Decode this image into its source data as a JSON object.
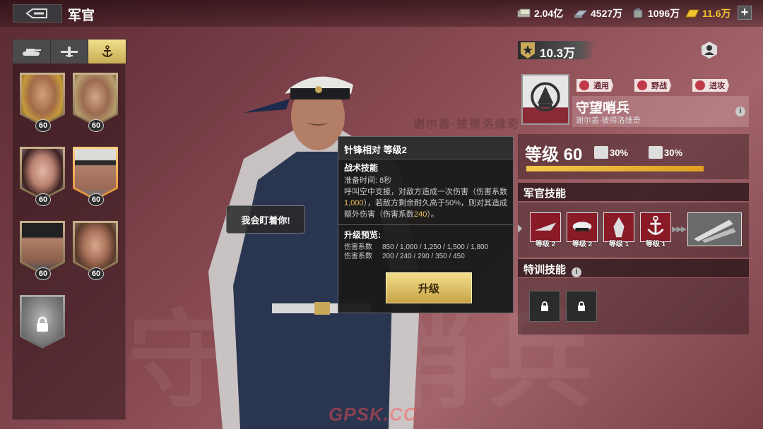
{
  "header": {
    "title": "军官",
    "resources": [
      {
        "icon": "cash-icon",
        "value": "2.04亿"
      },
      {
        "icon": "steel-icon",
        "value": "4527万"
      },
      {
        "icon": "oil-icon",
        "value": "1096万"
      },
      {
        "icon": "gold-icon",
        "value": "11.6万"
      }
    ],
    "plus": "+"
  },
  "tabs": [
    {
      "name": "tank-icon",
      "active": false
    },
    {
      "name": "plane-icon",
      "active": false
    },
    {
      "name": "anchor-icon",
      "active": true
    }
  ],
  "officers": [
    {
      "level": "60"
    },
    {
      "level": "60"
    },
    {
      "level": "60"
    },
    {
      "level": "60"
    },
    {
      "level": "60"
    },
    {
      "level": "60"
    },
    {
      "locked": true
    }
  ],
  "speech": "我会盯着你!",
  "background_text": "谢尔盖·彼得洛维奇",
  "background_glyphs": [
    "守",
    "望",
    "哨",
    "兵"
  ],
  "tooltip": {
    "title": "针锋相对 等级2",
    "type": "战术技能",
    "prep_label": "准备时间:",
    "prep_value": "8秒",
    "desc_a": "呼叫空中支援，对敌方造成一次伤害（伤害系数",
    "desc_val1": "1,000",
    "desc_b": "），若敌方剩余耐久高于50%，则对其造成额外伤害（伤害系数",
    "desc_val2": "240",
    "desc_c": "）。",
    "upgrade_title": "升级预览:",
    "coeff_label_1": "伤害系数",
    "coeff_values_1": "850 / 1,000 / 1,250 / 1,500 / 1,800",
    "coeff_label_2": "伤害系数",
    "coeff_values_2": "200 / 240 / 290 / 350 / 450",
    "upgrade_button": "升级"
  },
  "profile": {
    "power": "10.3万",
    "tags": [
      "通用",
      "野战",
      "进攻"
    ],
    "name": "守望哨兵",
    "subname": "谢尔盖·彼得洛维奇",
    "info": "i",
    "level": "等级 60",
    "stat1": "30%",
    "stat2": "30%",
    "xp_fraction": 1.0
  },
  "skills": {
    "title": "军官技能",
    "items": [
      {
        "icon": "jet-skill-icon",
        "label": "等级 2"
      },
      {
        "icon": "cap-skill-icon",
        "label": "等级 2"
      },
      {
        "icon": "mech-skill-icon",
        "label": "等级 1"
      },
      {
        "icon": "anchor-skill-icon",
        "label": "等级 1"
      }
    ],
    "arrows": "▶▶▶"
  },
  "special": {
    "title": "特训技能",
    "info": "i"
  },
  "watermark": "GPSK.CC",
  "colors": {
    "gold": "#f2c230",
    "accent_red": "#c22b3c",
    "button_gold": "#e3c46a"
  }
}
